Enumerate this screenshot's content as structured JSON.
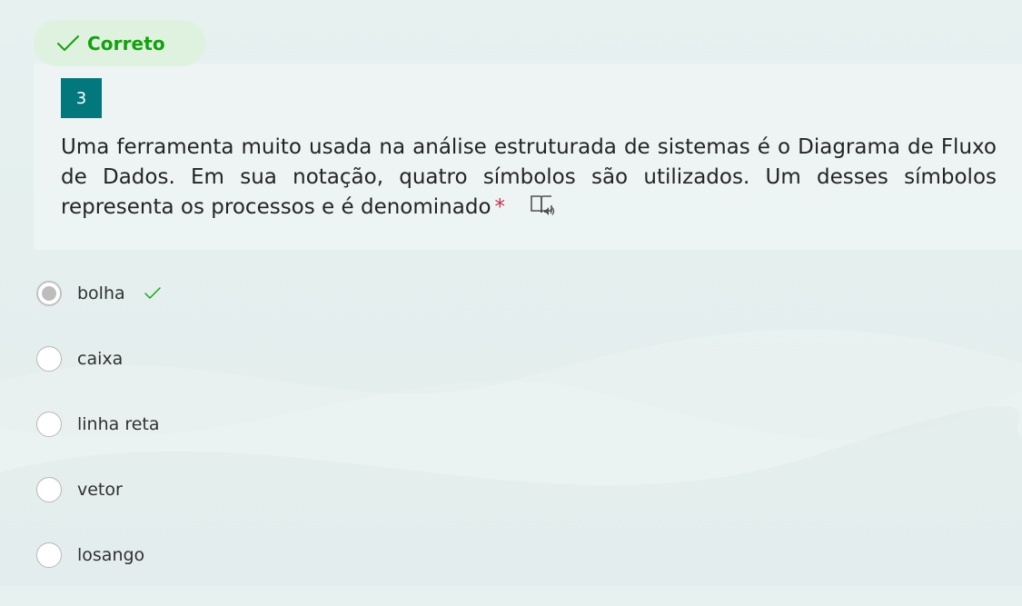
{
  "status": {
    "label": "Correto",
    "icon": "checkmark-icon",
    "color": "#13a10e"
  },
  "question": {
    "number": "3",
    "text": "Uma ferramenta muito usada na análise estruturada de sistemas é o Diagrama de Fluxo de Dados. Em sua notação, quatro símbolos são utilizados. Um desses símbolos representa os processos e é denominado",
    "required_marker": "*",
    "reader_icon": "immersive-reader-icon"
  },
  "options": [
    {
      "label": "bolha",
      "selected": true,
      "correct": true
    },
    {
      "label": "caixa",
      "selected": false,
      "correct": false
    },
    {
      "label": "linha reta",
      "selected": false,
      "correct": false
    },
    {
      "label": "vetor",
      "selected": false,
      "correct": false
    },
    {
      "label": "losango",
      "selected": false,
      "correct": false
    }
  ],
  "colors": {
    "accent": "#03787c",
    "correct": "#13a10e",
    "required": "#c4314b"
  }
}
